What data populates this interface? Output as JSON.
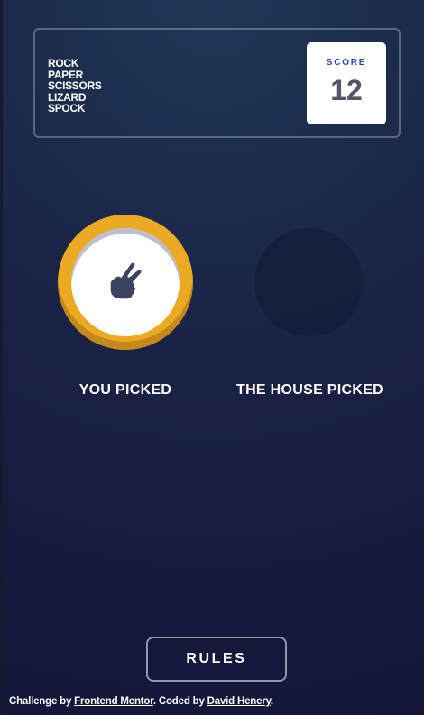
{
  "header": {
    "logo_lines": [
      "Rock",
      "Paper",
      "Scissors",
      "Lizard",
      "Spock"
    ],
    "score_label": "SCORE",
    "score_value": "12"
  },
  "picks": {
    "user": {
      "icon": "scissors-hand-icon",
      "ring_color": "#eca922",
      "caption": "YOU PICKED"
    },
    "house": {
      "caption": "THE HOUSE PICKED"
    }
  },
  "rules_button": {
    "label": "RULES"
  },
  "footer": {
    "prefix": "Challenge by ",
    "link1": "Frontend Mentor",
    "middle": ". Coded by ",
    "link2": "David Henery",
    "suffix": "."
  }
}
